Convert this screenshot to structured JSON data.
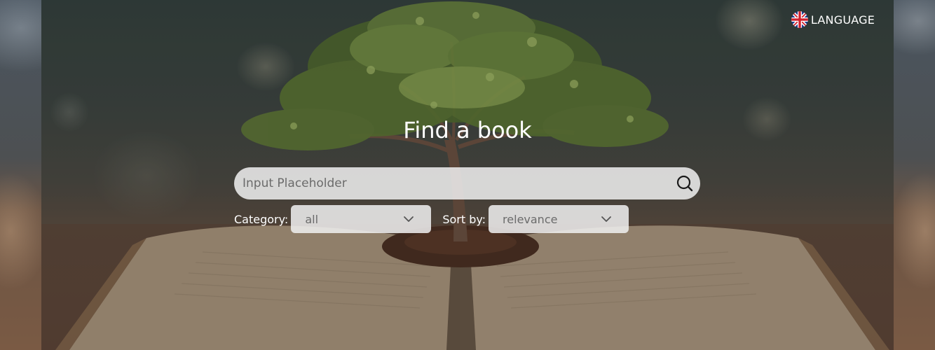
{
  "header": {
    "language_label": "LANGUAGE",
    "language_icon": "uk-flag-icon"
  },
  "search": {
    "title": "Find a book",
    "placeholder": "Input Placeholder",
    "value": "",
    "search_icon": "search-icon"
  },
  "filters": {
    "category": {
      "label": "Category:",
      "selected": "all"
    },
    "sort": {
      "label": "Sort by:",
      "selected": "relevance"
    }
  },
  "colors": {
    "text_light": "#ffffff",
    "input_bg": "#f0f0f0",
    "placeholder": "#6b6b6b"
  }
}
